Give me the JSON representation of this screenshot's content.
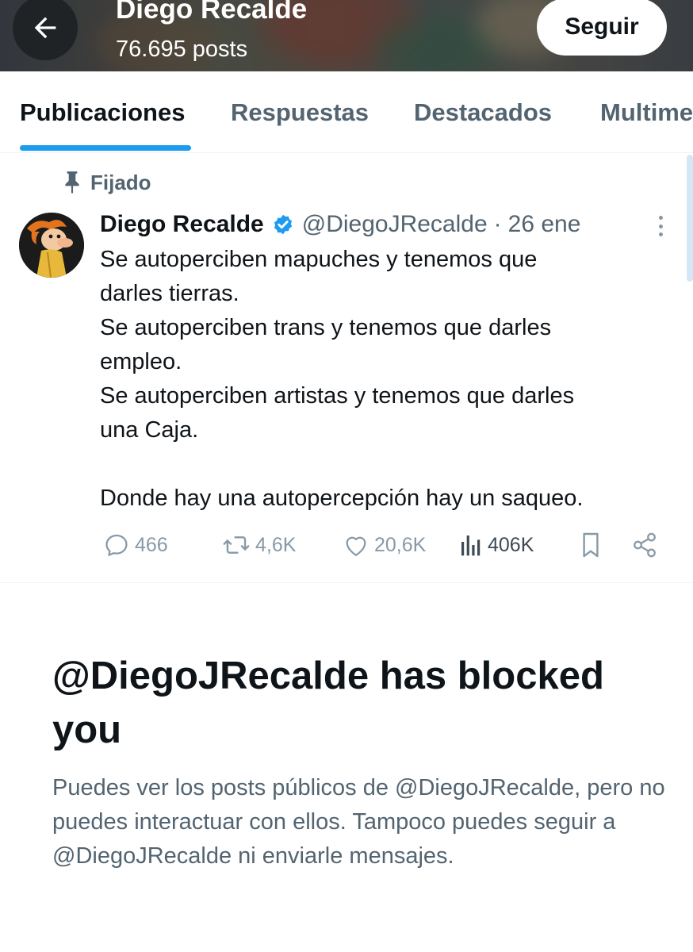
{
  "header": {
    "title": "Diego Recalde",
    "subtitle": "76.695 posts",
    "back_icon": "arrow-left-icon",
    "follow_label": "Seguir"
  },
  "tabs": [
    {
      "label": "Publicaciones",
      "active": true
    },
    {
      "label": "Respuestas",
      "active": false
    },
    {
      "label": "Destacados",
      "active": false
    },
    {
      "label": "Multime",
      "active": false
    }
  ],
  "tweet": {
    "pinned_label": "Fijado",
    "pinned_icon": "pin-icon",
    "author_name": "Diego Recalde",
    "verified_icon": "verified-badge-icon",
    "handle": "@DiegoJRecalde",
    "separator": "·",
    "date": "26 ene",
    "text_lines": [
      "Se autoperciben mapuches y tenemos que",
      "darles tierras.",
      "Se autoperciben trans y tenemos que darles",
      "empleo.",
      "Se autoperciben artistas y tenemos que darles",
      "una Caja.",
      "",
      "Donde hay una autopercepción hay un saqueo."
    ],
    "stats": {
      "replies": "466",
      "reposts": "4,6K",
      "likes": "20,6K",
      "views": "406K"
    },
    "colors": {
      "accent": "#1d9bf0",
      "muted": "#536471"
    }
  },
  "blocked": {
    "title": "@DiegoJRecalde has blocked you",
    "description": "Puedes ver los posts públicos de @DiegoJRecalde, pero no puedes interactuar con ellos. Tampoco puedes seguir a @DiegoJRecalde ni enviarle mensajes."
  }
}
